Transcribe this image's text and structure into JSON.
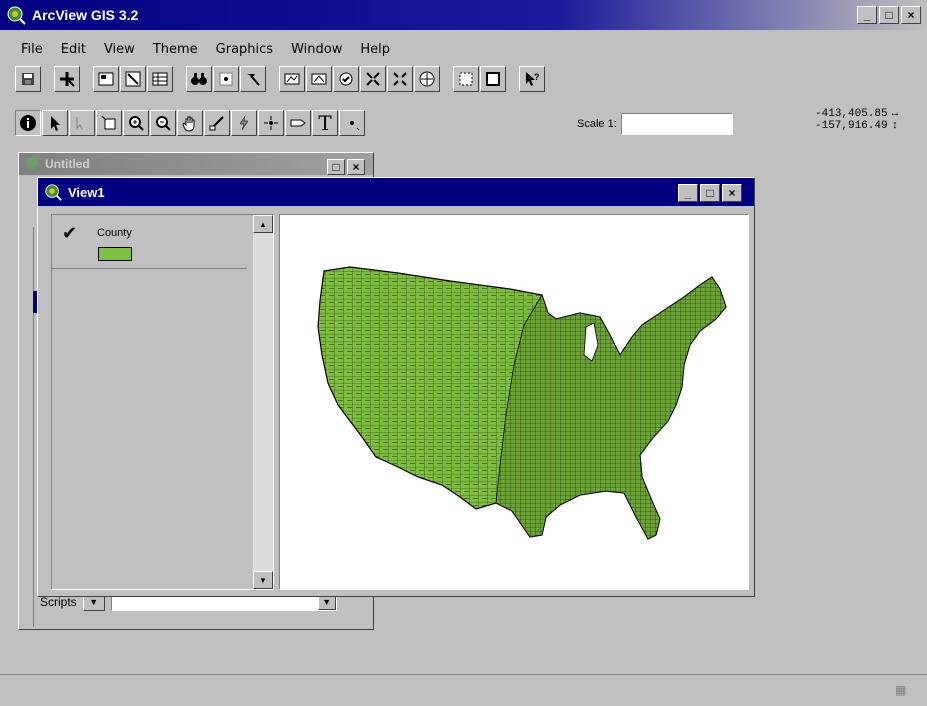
{
  "app": {
    "title": "ArcView GIS 3.2",
    "window_buttons": {
      "minimize": "_",
      "maximize": "□",
      "close": "×"
    }
  },
  "menu": [
    "File",
    "Edit",
    "View",
    "Theme",
    "Graphics",
    "Window",
    "Help"
  ],
  "toolbar2": {
    "text_tool": "T",
    "scale_label": "Scale 1:",
    "scale_value": ""
  },
  "coords": {
    "x": "-413,405.85",
    "y": "-157,916.49"
  },
  "background_window": {
    "title": "Untitled"
  },
  "scripts": {
    "label": "Scripts",
    "value": ""
  },
  "view": {
    "title": "View1",
    "theme": {
      "name": "County",
      "visible": true,
      "fill_color": "#7fbf3f"
    }
  },
  "icons": {
    "app": "arcview-globe-icon",
    "save": "save-icon",
    "add_theme": "add-theme-icon",
    "identify": "identify-icon",
    "pointer": "pointer-icon",
    "zoom_in": "zoom-in-icon",
    "zoom_out": "zoom-out-icon",
    "pan": "pan-hand-icon",
    "help": "help-pointer-icon"
  }
}
